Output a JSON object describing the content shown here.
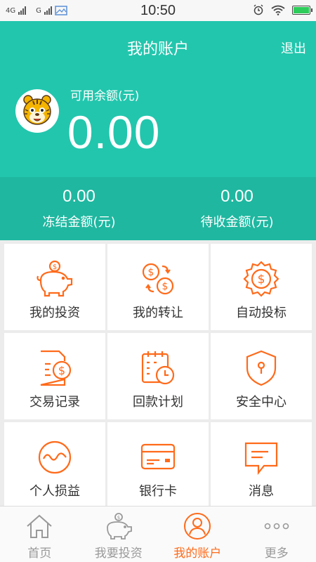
{
  "status_bar": {
    "network_1": "4G",
    "network_2": "G",
    "time": "10:50",
    "icons": [
      "alarm-icon",
      "wifi-icon",
      "battery-icon"
    ]
  },
  "header": {
    "title": "我的账户",
    "logout_label": "退出",
    "balance_label": "可用余额(元)",
    "balance_value": "0.00",
    "frozen": {
      "value": "0.00",
      "label": "冻结金额(元)"
    },
    "pending": {
      "value": "0.00",
      "label": "待收金额(元)"
    }
  },
  "menu": [
    {
      "label": "我的投资",
      "icon": "piggy-bank-icon"
    },
    {
      "label": "我的转让",
      "icon": "transfer-icon"
    },
    {
      "label": "自动投标",
      "icon": "auto-bid-icon"
    },
    {
      "label": "交易记录",
      "icon": "transaction-record-icon"
    },
    {
      "label": "回款计划",
      "icon": "repayment-calendar-icon"
    },
    {
      "label": "安全中心",
      "icon": "shield-icon"
    },
    {
      "label": "个人损益",
      "icon": "profit-loss-icon"
    },
    {
      "label": "银行卡",
      "icon": "bank-card-icon"
    },
    {
      "label": "消息",
      "icon": "message-icon"
    }
  ],
  "tabs": [
    {
      "label": "首页",
      "icon": "home-icon",
      "active": false
    },
    {
      "label": "我要投资",
      "icon": "piggy-bank-icon",
      "active": false
    },
    {
      "label": "我的账户",
      "icon": "account-icon",
      "active": true
    },
    {
      "label": "更多",
      "icon": "more-icon",
      "active": false
    }
  ],
  "colors": {
    "primary": "#22c6ad",
    "primary_dark": "#1fb7a0",
    "accent": "#ff6a1a"
  }
}
